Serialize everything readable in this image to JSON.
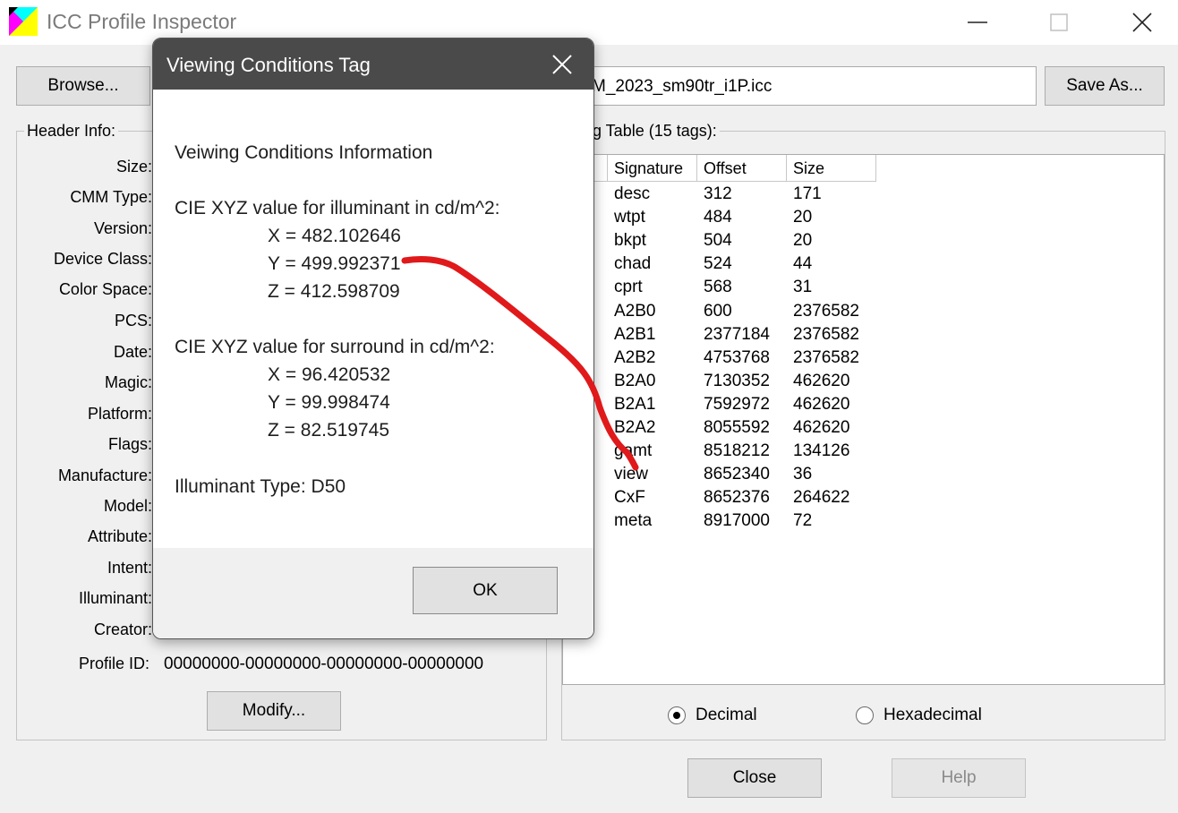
{
  "window": {
    "title": "ICC Profile Inspector"
  },
  "toolbar": {
    "browse_label": "Browse...",
    "file_name_visible": "M_2023_sm90tr_i1P.icc",
    "save_as_label": "Save As..."
  },
  "header_info": {
    "group_label": "Header Info:",
    "labels": [
      "Size:",
      "CMM Type:",
      "Version:",
      "Device Class:",
      "Color Space:",
      "PCS:",
      "Date:",
      "Magic:",
      "Platform:",
      "Flags:",
      "Manufacture:",
      "Model:",
      "Attribute:",
      "Intent:",
      "Illuminant:",
      "Creator:"
    ],
    "profile_id_label": "Profile ID:",
    "profile_id_value": "00000000-00000000-00000000-00000000",
    "modify_label": "Modify..."
  },
  "tag_table": {
    "group_label_visible": "g Table (15 tags):",
    "columns": [
      "Signature",
      "Offset",
      "Size"
    ],
    "rows": [
      {
        "signature": "desc",
        "offset": "312",
        "size": "171"
      },
      {
        "signature": "wtpt",
        "offset": "484",
        "size": "20"
      },
      {
        "signature": "bkpt",
        "offset": "504",
        "size": "20"
      },
      {
        "signature": "chad",
        "offset": "524",
        "size": "44"
      },
      {
        "signature": "cprt",
        "offset": "568",
        "size": "31"
      },
      {
        "signature": "A2B0",
        "offset": "600",
        "size": "2376582"
      },
      {
        "signature": "A2B1",
        "offset": "2377184",
        "size": "2376582"
      },
      {
        "signature": "A2B2",
        "offset": "4753768",
        "size": "2376582"
      },
      {
        "signature": "B2A0",
        "offset": "7130352",
        "size": "462620"
      },
      {
        "signature": "B2A1",
        "offset": "7592972",
        "size": "462620"
      },
      {
        "signature": "B2A2",
        "offset": "8055592",
        "size": "462620"
      },
      {
        "signature": "gamt",
        "offset": "8518212",
        "size": "134126"
      },
      {
        "signature": "view",
        "offset": "8652340",
        "size": "36"
      },
      {
        "signature": "CxF",
        "offset": "8652376",
        "size": "264622"
      },
      {
        "signature": "meta",
        "offset": "8917000",
        "size": "72"
      }
    ]
  },
  "number_format": {
    "decimal_label": "Decimal",
    "hex_label": "Hexadecimal",
    "selected": "Decimal"
  },
  "footer": {
    "close_label": "Close",
    "help_label": "Help"
  },
  "dialog": {
    "title": "Viewing Conditions Tag",
    "heading": "Veiwing Conditions Information",
    "illuminant_label": "CIE XYZ value for illuminant in cd/m^2:",
    "illuminant_x": "X = 482.102646",
    "illuminant_y": "Y = 499.992371",
    "illuminant_z": "Z = 412.598709",
    "surround_label": "CIE XYZ value for surround in cd/m^2:",
    "surround_x": "X = 96.420532",
    "surround_y": "Y = 99.998474",
    "surround_z": "Z = 82.519745",
    "illuminant_type": "Illuminant Type: D50",
    "ok_label": "OK"
  },
  "annotation": {
    "color": "#e0191b"
  },
  "colors": {
    "dialog_titlebar": "#4a4a4a",
    "window_bg": "#f0f0f0"
  }
}
